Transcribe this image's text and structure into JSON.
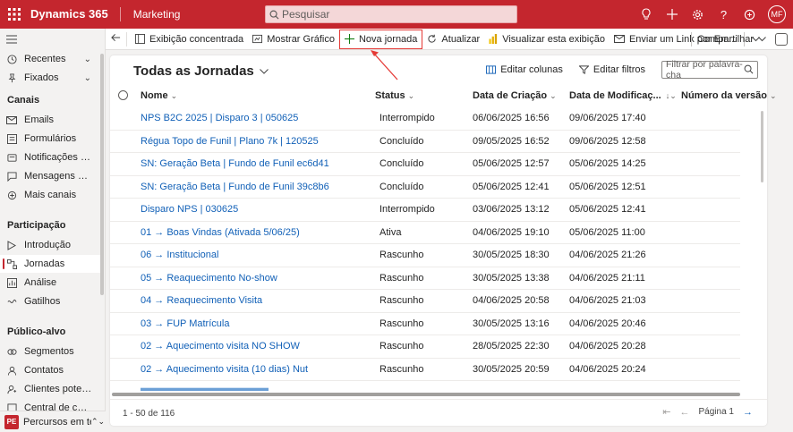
{
  "topbar": {
    "brand": "Dynamics 365",
    "app": "Marketing",
    "search_placeholder": "Pesquisar",
    "avatar": "MF"
  },
  "sidebar": {
    "recent": "Recentes",
    "pinned": "Fixados",
    "section_channels": "Canais",
    "channels": [
      "Emails",
      "Formulários",
      "Notificações por ...",
      "Mensagens de tex...",
      "Mais canais"
    ],
    "section_engagement": "Participação",
    "engagement": [
      "Introdução",
      "Jornadas",
      "Análise",
      "Gatilhos"
    ],
    "section_audience": "Público-alvo",
    "audience": [
      "Segmentos",
      "Contatos",
      "Clientes potenciais",
      "Central de consen..."
    ],
    "area_badge": "PE",
    "area_label": "Percursos em tem..."
  },
  "commandbar": {
    "focused_view": "Exibição concentrada",
    "show_chart": "Mostrar Gráfico",
    "new_journey": "Nova jornada",
    "refresh": "Atualizar",
    "visualize": "Visualizar esta exibição",
    "send_link": "Enviar um Link por Em...",
    "share": "Compartilhar"
  },
  "view": {
    "title": "Todas as Jornadas",
    "edit_columns": "Editar colunas",
    "edit_filters": "Editar filtros",
    "filter_placeholder": "Filtrar por palavra-cha"
  },
  "grid": {
    "columns": {
      "name": "Nome",
      "status": "Status",
      "created": "Data de Criação",
      "modified": "Data de Modificaç...",
      "version": "Número da versão"
    },
    "rows": [
      {
        "name": "NPS B2C 2025 | Disparo 3 | 050625",
        "status": "Interrompido",
        "created": "06/06/2025 16:56",
        "modified": "09/06/2025 17:40"
      },
      {
        "name": "Régua Topo de Funil | Plano 7k | 120525",
        "status": "Concluído",
        "created": "09/05/2025 16:52",
        "modified": "09/06/2025 12:58"
      },
      {
        "name": "SN: Geração Beta | Fundo de Funil ec6d41",
        "status": "Concluído",
        "created": "05/06/2025 12:57",
        "modified": "05/06/2025 14:25"
      },
      {
        "name": "SN: Geração Beta | Fundo de Funil 39c8b6",
        "status": "Concluído",
        "created": "05/06/2025 12:41",
        "modified": "05/06/2025 12:51"
      },
      {
        "name": "Disparo NPS | 030625",
        "status": "Interrompido",
        "created": "03/06/2025 13:12",
        "modified": "05/06/2025 12:41"
      },
      {
        "name": "01 → Boas Vindas (Ativada 5/06/25)",
        "status": "Ativa",
        "created": "04/06/2025 19:10",
        "modified": "05/06/2025 11:00"
      },
      {
        "name": "06 → Institucional",
        "status": "Rascunho",
        "created": "30/05/2025 18:30",
        "modified": "04/06/2025 21:26"
      },
      {
        "name": "05 → Reaquecimento No-show",
        "status": "Rascunho",
        "created": "30/05/2025 13:38",
        "modified": "04/06/2025 21:11"
      },
      {
        "name": "04 → Reaquecimento Visita",
        "status": "Rascunho",
        "created": "04/06/2025 20:58",
        "modified": "04/06/2025 21:03"
      },
      {
        "name": "03 → FUP Matrícula",
        "status": "Rascunho",
        "created": "30/05/2025 13:16",
        "modified": "04/06/2025 20:46"
      },
      {
        "name": "02 → Aquecimento visita NO SHOW",
        "status": "Rascunho",
        "created": "28/05/2025 22:30",
        "modified": "04/06/2025 20:28"
      },
      {
        "name": "02 → Aquecimento visita (10 dias) Nut",
        "status": "Rascunho",
        "created": "30/05/2025 20:59",
        "modified": "04/06/2025 20:24"
      }
    ]
  },
  "footer": {
    "count": "1 - 50 de 116",
    "page": "Página 1"
  },
  "colors": {
    "brand": "#c4262e",
    "link": "#1160b7",
    "highlight": "#e53935"
  }
}
